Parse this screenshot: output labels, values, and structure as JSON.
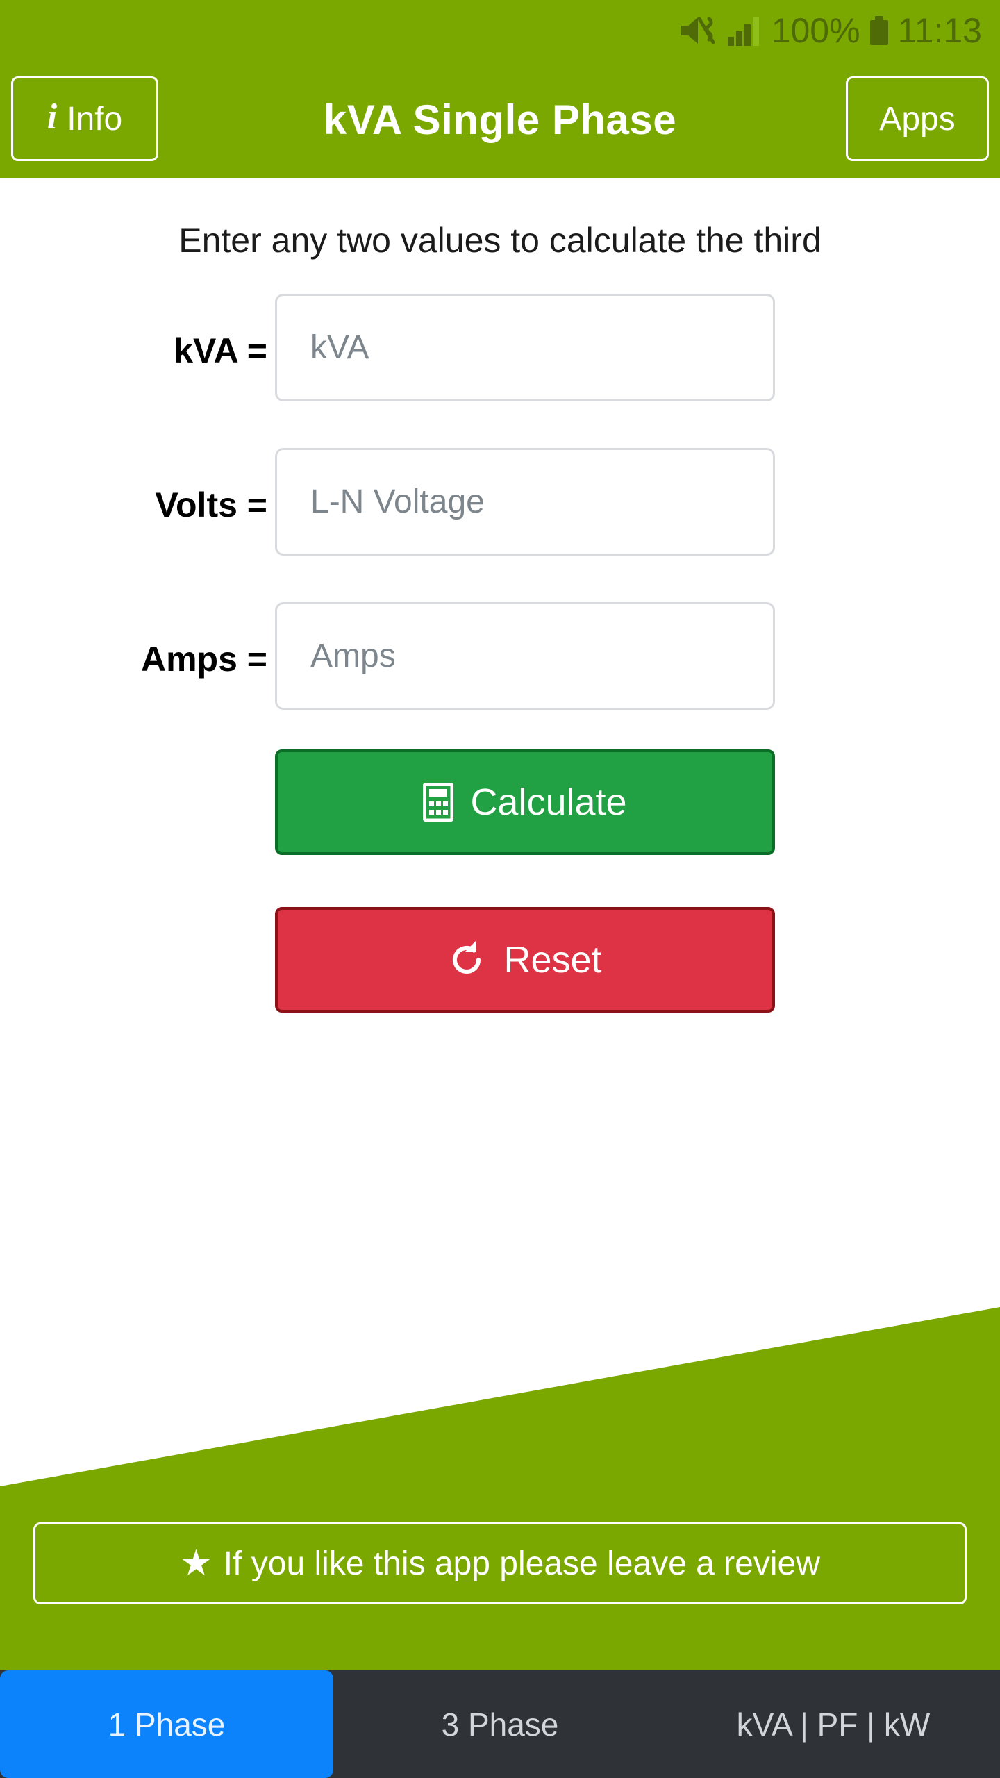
{
  "status_bar": {
    "mute_icon": "volume-mute-vibrate-icon",
    "signal_icon": "cellular-signal-icon",
    "battery_percent": "100%",
    "battery_icon": "battery-full-icon",
    "time": "11:13"
  },
  "app_bar": {
    "info_button": "Info",
    "info_icon": "info-i-icon",
    "title": "kVA Single Phase",
    "apps_button": "Apps"
  },
  "main": {
    "hint": "Enter any two values to calculate the third",
    "fields": [
      {
        "label": "kVA =",
        "placeholder": "kVA",
        "value": ""
      },
      {
        "label": "Volts =",
        "placeholder": "L-N Voltage",
        "value": ""
      },
      {
        "label": "Amps =",
        "placeholder": "Amps",
        "value": ""
      }
    ],
    "calculate_button": {
      "label": "Calculate",
      "icon": "calculator-icon"
    },
    "reset_button": {
      "label": "Reset",
      "icon": "refresh-cw-icon"
    }
  },
  "review_banner": {
    "star_icon": "star-icon",
    "text": "If you like this app please leave a review"
  },
  "tabs": [
    {
      "label": "1 Phase",
      "active": true
    },
    {
      "label": "3 Phase",
      "active": false
    },
    {
      "label": "kVA | PF | kW",
      "active": false
    }
  ],
  "colors": {
    "brand_green": "#7aa800",
    "status_text": "#4f6b07",
    "calculate_green": "#21a144",
    "calculate_border": "#0a6e26",
    "reset_red": "#dd3344",
    "reset_border": "#8d1218",
    "tabbar_dark": "#2f3337",
    "tab_active_blue": "#0c82fb",
    "input_border": "#d8dade",
    "placeholder_grey": "#7d868c"
  }
}
